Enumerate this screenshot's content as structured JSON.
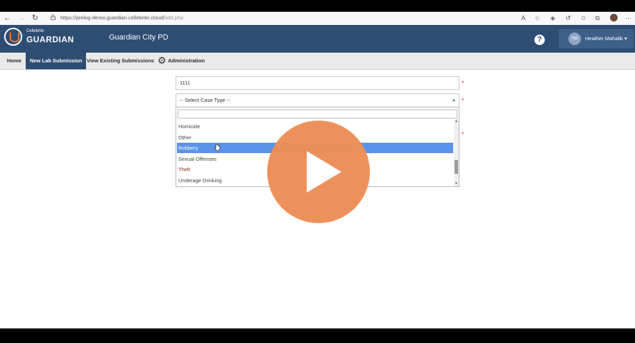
{
  "browser": {
    "url_base": "https://prelog-demo.guardian.cellebrite.cloud/",
    "url_path": "add.php"
  },
  "header": {
    "logo_small": "Cellebrite",
    "logo_big": "GUARDIAN",
    "org_name": "Guardian City PD",
    "help_label": "?",
    "user_initials": "HM",
    "user_name": "Heather Mahalik ▾"
  },
  "menu": {
    "home": "Home",
    "new_lab": "New Lab Submission",
    "view_existing": "View Existing Submissions",
    "administration": "Administration"
  },
  "form": {
    "case_number": "1111",
    "case_type_placeholder": "-- Select Case Type --",
    "required_mark": "*",
    "options": [
      "Homicide",
      "Other",
      "Robbery",
      "Sexual Offenses",
      "Theft",
      "Underage Drinking"
    ],
    "selected_option": "Robbery"
  },
  "colors": {
    "header_bg": "#2e4d73",
    "selected_option": "#5b93e8",
    "play_button": "#ed8e57"
  }
}
